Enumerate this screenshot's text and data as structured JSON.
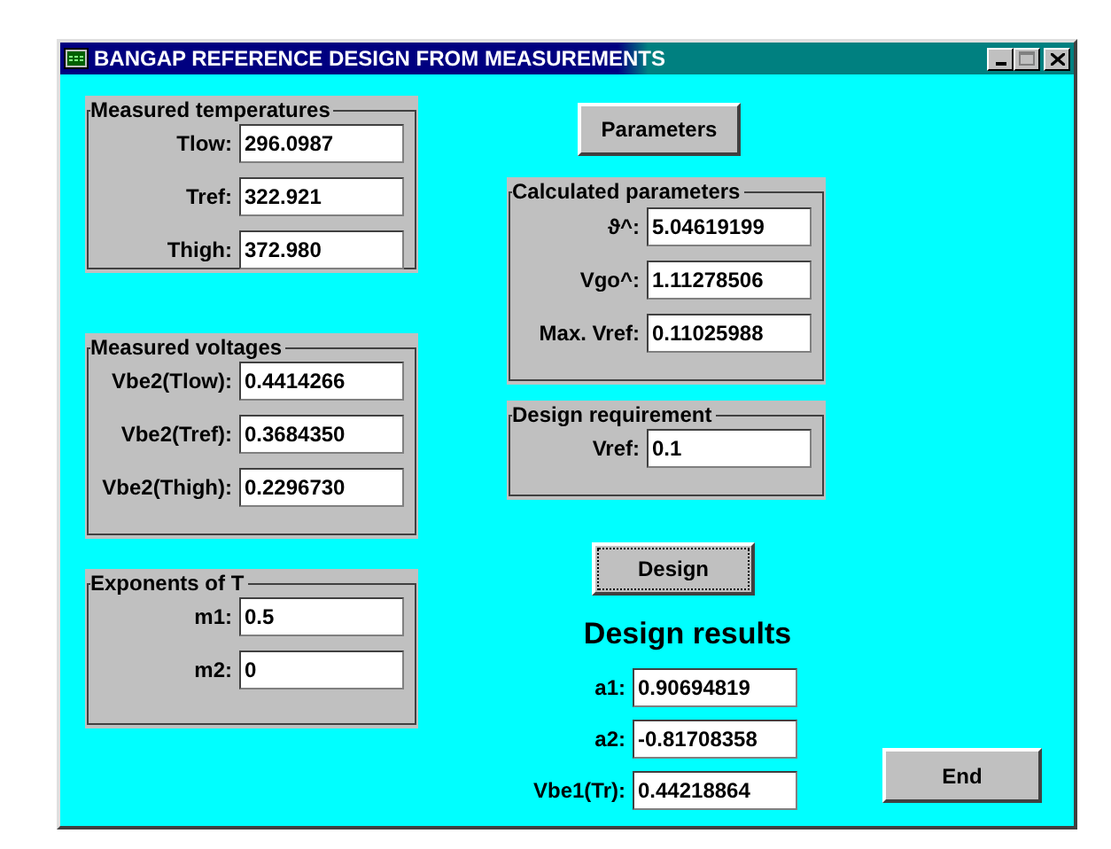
{
  "window": {
    "title": "BANGAP REFERENCE DESIGN FROM MEASUREMENTS"
  },
  "left_groups": [
    {
      "title": "Measured temperatures",
      "fields": [
        {
          "label": "Tlow:",
          "value": "296.0987"
        },
        {
          "label": "Tref:",
          "value": "322.921"
        },
        {
          "label": "Thigh:",
          "value": "372.980"
        }
      ]
    },
    {
      "title": "Measured voltages",
      "fields": [
        {
          "label": "Vbe2(Tlow):",
          "value": "0.4414266"
        },
        {
          "label": "Vbe2(Tref):",
          "value": "0.3684350"
        },
        {
          "label": "Vbe2(Thigh):",
          "value": "0.2296730"
        }
      ]
    },
    {
      "title": "Exponents of T",
      "fields": [
        {
          "label": "m1:",
          "value": "0.5"
        },
        {
          "label": "m2:",
          "value": "0"
        }
      ]
    }
  ],
  "parameters_button": {
    "label": "Parameters",
    "focused": false
  },
  "calculated_parameters": {
    "title": "Calculated parameters",
    "fields": [
      {
        "label": "ϑ^:",
        "value": "5.04619199"
      },
      {
        "label": "Vgo^:",
        "value": "1.11278506"
      },
      {
        "label": "Max. Vref:",
        "value": "0.11025988"
      }
    ]
  },
  "design_requirement": {
    "title": "Design requirement",
    "fields": [
      {
        "label": "Vref:",
        "value": "0.1"
      }
    ]
  },
  "design_button": {
    "label": "Design",
    "focused": true
  },
  "design_results": {
    "title": "Design results",
    "fields": [
      {
        "label": "a1:",
        "value": "0.90694819"
      },
      {
        "label": "a2:",
        "value": "-0.81708358"
      },
      {
        "label": "Vbe1(Tr):",
        "value": "0.44218864"
      }
    ]
  },
  "end_button": {
    "label": "End",
    "focused": false
  }
}
